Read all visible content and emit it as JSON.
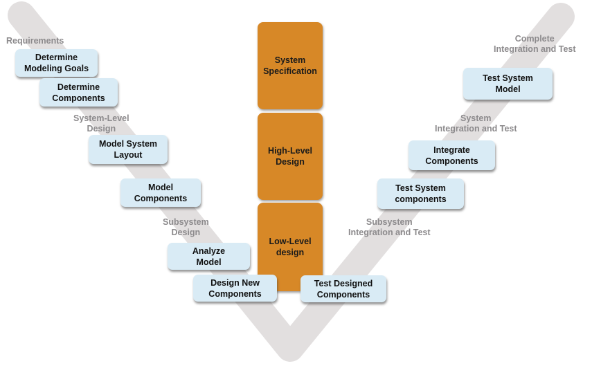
{
  "colors": {
    "v_band": "#e2dfdf",
    "step_box": "#d9ebf5",
    "level_block": "#d78827",
    "phase_label": "#8c8a8c"
  },
  "phase_labels": {
    "requirements": "Requirements",
    "system_level_design": "System-Level\nDesign",
    "subsystem_design": "Subsystem\nDesign",
    "subsystem_integration": "Subsystem\nIntegration and Test",
    "system_integration": "System\nIntegration and Test",
    "complete_integration": "Complete\nIntegration and Test"
  },
  "left_steps": [
    {
      "label": "Determine\nModeling Goals"
    },
    {
      "label": "Determine\nComponents"
    },
    {
      "label": "Model System\nLayout"
    },
    {
      "label": "Model\nComponents"
    },
    {
      "label": "Analyze\nModel"
    },
    {
      "label": "Design New\nComponents"
    }
  ],
  "right_steps": [
    {
      "label": "Test Designed\nComponents"
    },
    {
      "label": "Test System\ncomponents"
    },
    {
      "label": "Integrate\nComponents"
    },
    {
      "label": "Test System\nModel"
    }
  ],
  "levels": [
    {
      "label": "System\nSpecification"
    },
    {
      "label": "High-Level\nDesign"
    },
    {
      "label": "Low-Level\ndesign"
    }
  ]
}
